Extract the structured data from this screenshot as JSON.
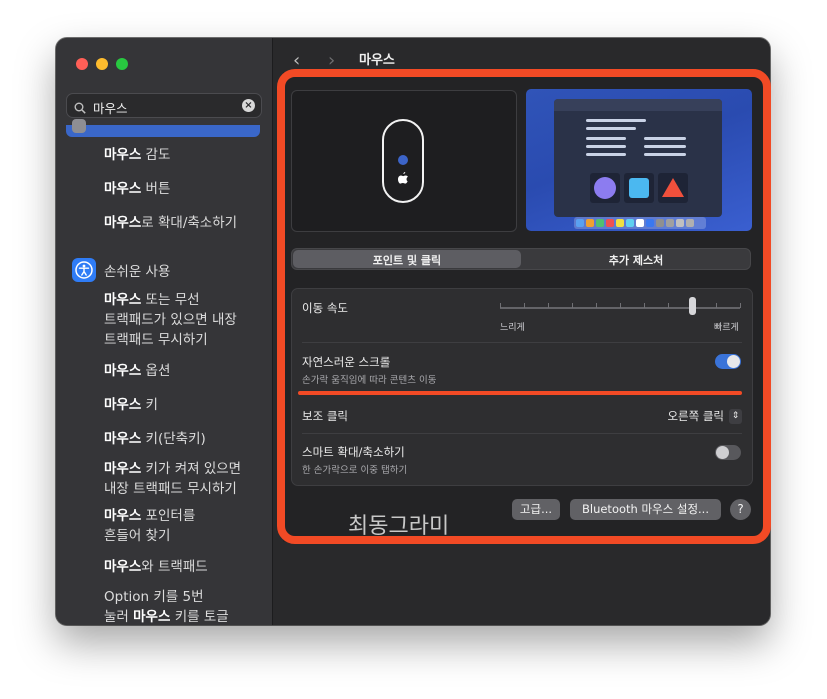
{
  "header": {
    "title": "마우스",
    "back_icon": "chevron-left-icon",
    "forward_icon": "chevron-right-icon"
  },
  "search": {
    "value": "마우스",
    "icon": "search-icon",
    "clear_icon": "clear-icon"
  },
  "sidebar": {
    "items": [
      {
        "prefix": "",
        "bold": "마우스",
        "suffix": " 감도"
      },
      {
        "prefix": "",
        "bold": "마우스",
        "suffix": " 버튼"
      },
      {
        "prefix": "",
        "bold": "마우스",
        "suffix": "로 확대/축소하기"
      }
    ],
    "category": {
      "label": "손쉬운 사용",
      "icon": "accessibility-icon",
      "color": "#2f7cf6"
    },
    "sub_items": [
      {
        "prefix": "",
        "bold": "마우스",
        "suffix": " 또는 무선",
        "line2": "트랙패드가 있으면 내장",
        "line3": "트랙패드 무시하기"
      },
      {
        "prefix": "",
        "bold": "마우스",
        "suffix": " 옵션"
      },
      {
        "prefix": "",
        "bold": "마우스",
        "suffix": " 키"
      },
      {
        "prefix": "",
        "bold": "마우스",
        "suffix": " 키(단축키)"
      },
      {
        "prefix": "",
        "bold": "마우스",
        "suffix": " 키가 켜져 있으면",
        "line2": "내장 트랙패드 무시하기"
      },
      {
        "prefix": "",
        "bold": "마우스",
        "suffix": " 포인터를",
        "line2": "흔들어 찾기"
      },
      {
        "prefix": "",
        "bold": "마우스",
        "suffix": "와 트랙패드"
      },
      {
        "prefix": "Option 키를 5번",
        "line2_prefix": "눌러 ",
        "line2_bold": "마우스",
        "line2_suffix": " 키를 토글"
      }
    ]
  },
  "tabs": [
    {
      "label": "포인트 및 클릭",
      "selected": true
    },
    {
      "label": "추가 제스처",
      "selected": false
    }
  ],
  "settings": {
    "tracking_speed": {
      "label": "이동 속도",
      "min_label": "느리게",
      "max_label": "빠르게",
      "value_fraction": 0.8
    },
    "natural_scroll": {
      "label": "자연스러운 스크롤",
      "description": "손가락 움직임에 따라 콘텐츠 이동",
      "enabled": true
    },
    "secondary_click": {
      "label": "보조 클릭",
      "value": "오른쪽 클릭"
    },
    "smart_zoom": {
      "label": "스마트 확대/축소하기",
      "description": "한 손가락으로 이중 탭하기",
      "enabled": false
    }
  },
  "buttons": {
    "advanced": "고급...",
    "bluetooth": "Bluetooth 마우스 설정...",
    "help": "?"
  },
  "watermark": "최동그라미",
  "colors": {
    "accent": "#3a67c9",
    "annotation_red": "#f24a25",
    "toggle_on": "#3a73d8"
  }
}
